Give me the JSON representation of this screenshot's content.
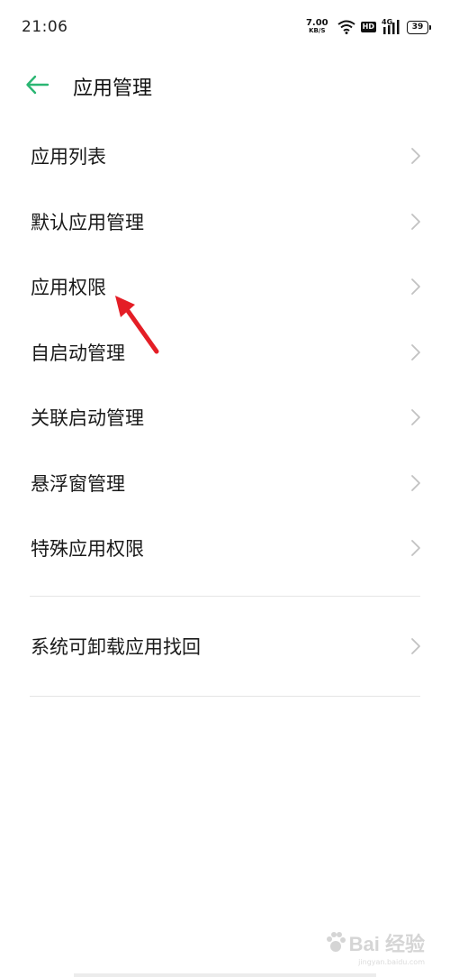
{
  "status_bar": {
    "time": "21:06",
    "net_speed_value": "7.00",
    "net_speed_unit": "KB/S",
    "hd_label": "HD",
    "network_type": "4G",
    "battery_level": "39"
  },
  "header": {
    "title": "应用管理"
  },
  "menu": {
    "items": [
      {
        "label": "应用列表"
      },
      {
        "label": "默认应用管理"
      },
      {
        "label": "应用权限"
      },
      {
        "label": "自启动管理"
      },
      {
        "label": "关联启动管理"
      },
      {
        "label": "悬浮窗管理"
      },
      {
        "label": "特殊应用权限"
      }
    ],
    "recovery": {
      "label": "系统可卸载应用找回"
    }
  },
  "watermark": {
    "text": "Bai 经验",
    "sub": "jingyan.baidu.com"
  },
  "colors": {
    "accent": "#2bb673",
    "annotation": "#e41e26",
    "chevron": "#c2c2c2",
    "divider": "#e5e5e5"
  }
}
